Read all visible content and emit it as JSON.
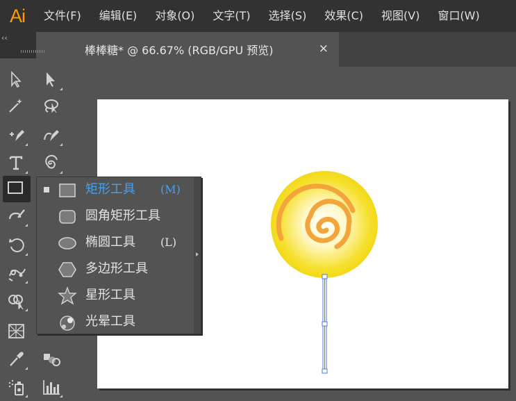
{
  "app": {
    "logo": "Ai",
    "accent_color": "#ff9a00"
  },
  "menu": [
    {
      "label": "文件(F)"
    },
    {
      "label": "编辑(E)"
    },
    {
      "label": "对象(O)"
    },
    {
      "label": "文字(T)"
    },
    {
      "label": "选择(S)"
    },
    {
      "label": "效果(C)"
    },
    {
      "label": "视图(V)"
    },
    {
      "label": "窗口(W)"
    }
  ],
  "document_tab": {
    "title": "棒棒糖* @ 66.67% (RGB/GPU 预览)",
    "close_glyph": "×"
  },
  "toolbar": {
    "collapse_glyph": "‹‹",
    "tools": [
      {
        "name": "selection-tool-icon"
      },
      {
        "name": "direct-selection-tool-icon"
      },
      {
        "name": "magic-wand-tool-icon"
      },
      {
        "name": "lasso-tool-icon"
      },
      {
        "name": "pen-tool-icon"
      },
      {
        "name": "curvature-tool-icon"
      },
      {
        "name": "type-tool-icon"
      },
      {
        "name": "spiral-tool-icon"
      },
      {
        "name": "rectangle-tool-icon"
      },
      {
        "name": "paintbrush-tool-icon"
      },
      {
        "name": "rotate-tool-icon"
      },
      {
        "name": "puppet-warp-tool-icon"
      },
      {
        "name": "shape-builder-tool-icon"
      },
      {
        "name": "perspective-grid-tool-icon"
      },
      {
        "name": "gradient-tool-icon"
      },
      {
        "name": "eyedropper-tool-icon"
      },
      {
        "name": "blend-tool-icon"
      },
      {
        "name": "symbol-sprayer-tool-icon"
      },
      {
        "name": "column-graph-tool-icon"
      }
    ]
  },
  "flyout": {
    "items": [
      {
        "label": "矩形工具",
        "shortcut": "(M)",
        "icon": "rectangle-icon",
        "selected": true
      },
      {
        "label": "圆角矩形工具",
        "shortcut": "",
        "icon": "rounded-rectangle-icon",
        "selected": false
      },
      {
        "label": "椭圆工具",
        "shortcut": "(L)",
        "icon": "ellipse-icon",
        "selected": false
      },
      {
        "label": "多边形工具",
        "shortcut": "",
        "icon": "polygon-icon",
        "selected": false
      },
      {
        "label": "星形工具",
        "shortcut": "",
        "icon": "star-icon",
        "selected": false
      },
      {
        "label": "光晕工具",
        "shortcut": "",
        "icon": "flare-icon",
        "selected": false
      }
    ],
    "selected_color": "#4a9eea"
  },
  "artwork": {
    "candy_outer_color": "#f6e02a",
    "candy_inner_color": "#ffffff",
    "spiral_color": "#f3a43a",
    "stick_color": "#ffffff",
    "selection_color": "#4a7ed6"
  }
}
